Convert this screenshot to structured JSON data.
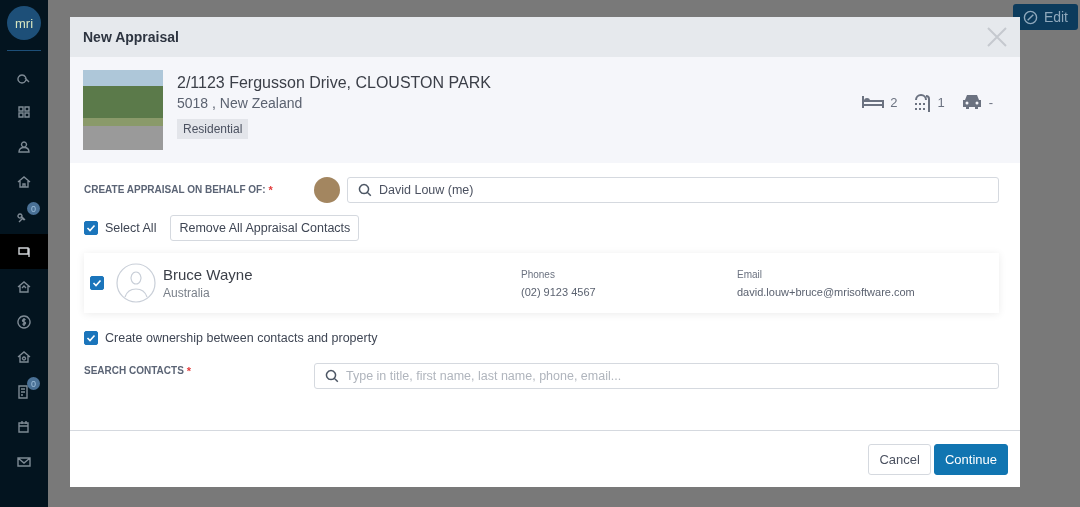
{
  "sidebar": {
    "logo": "mri",
    "items": [
      {
        "selected": false
      },
      {
        "selected": false
      },
      {
        "selected": false
      },
      {
        "selected": false
      },
      {
        "selected": false,
        "badge": "0"
      },
      {
        "selected": true
      },
      {
        "selected": false
      },
      {
        "selected": false
      },
      {
        "selected": false
      },
      {
        "selected": false,
        "badge": "0"
      },
      {
        "selected": false
      },
      {
        "selected": false
      }
    ]
  },
  "header": {
    "edit_button": "Edit"
  },
  "modal": {
    "title": "New Appraisal",
    "property": {
      "address": "2/1123 Fergusson Drive, CLOUSTON PARK",
      "locality": "5018 , New Zealand",
      "tag": "Residential",
      "features": [
        {
          "kind": "bed",
          "value": "2"
        },
        {
          "kind": "bath",
          "value": "1"
        },
        {
          "kind": "car",
          "value": "-"
        }
      ]
    },
    "behalf": {
      "label": "CREATE APPRAISAL ON BEHALF OF:",
      "required_mark": "*",
      "value": "David Louw (me)"
    },
    "select_all": {
      "label": "Select All",
      "checked": true
    },
    "remove_button": "Remove All Appraisal Contacts",
    "contacts": [
      {
        "checked": true,
        "name": "Bruce Wayne",
        "location": "Australia",
        "phones_label": "Phones",
        "phone": "(02) 9123 4567",
        "email_label": "Email",
        "email": "david.louw+bruce@mrisoftware.com"
      }
    ],
    "ownership": {
      "label": "Create ownership between contacts and property",
      "checked": true
    },
    "search_contacts": {
      "label": "SEARCH CONTACTS",
      "required_mark": "*",
      "placeholder": "Type in title, first name, last name, phone, email..."
    },
    "buttons": [
      {
        "label": "Cancel",
        "kind": "secondary"
      },
      {
        "label": "Continue",
        "kind": "primary"
      }
    ]
  }
}
